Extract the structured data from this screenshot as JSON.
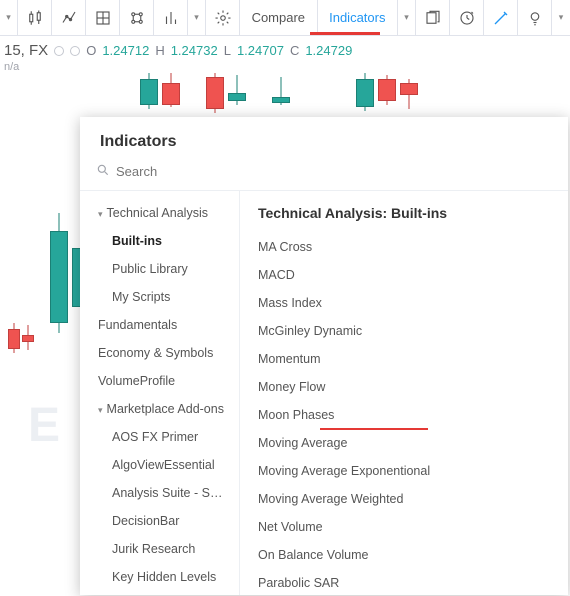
{
  "toolbar": {
    "compare_label": "Compare",
    "indicators_label": "Indicators"
  },
  "ohlc": {
    "symbol_text": "15, FX",
    "o_label": "O",
    "o": "1.24712",
    "h_label": "H",
    "h": "1.24732",
    "l_label": "L",
    "l": "1.24707",
    "c_label": "C",
    "c": "1.24729",
    "na": "n/a"
  },
  "modal": {
    "title": "Indicators",
    "search_placeholder": "Search",
    "nav": {
      "tech": "Technical Analysis",
      "builtins": "Built-ins",
      "publib": "Public Library",
      "myscripts": "My Scripts",
      "fundamentals": "Fundamentals",
      "econ": "Economy & Symbols",
      "volprof": "VolumeProfile",
      "marketplace": "Marketplace Add-ons",
      "aos": "AOS FX Primer",
      "algoview": "AlgoViewEssential",
      "ascm": "Analysis Suite - SCM...",
      "decision": "DecisionBar",
      "jurik": "Jurik Research",
      "khl": "Key Hidden Levels"
    },
    "list": {
      "heading": "Technical Analysis: Built-ins",
      "items": [
        "MA Cross",
        "MACD",
        "Mass Index",
        "McGinley Dynamic",
        "Momentum",
        "Money Flow",
        "Moon Phases",
        "Moving Average",
        "Moving Average Exponentional",
        "Moving Average Weighted",
        "Net Volume",
        "On Balance Volume",
        "Parabolic SAR"
      ]
    }
  }
}
